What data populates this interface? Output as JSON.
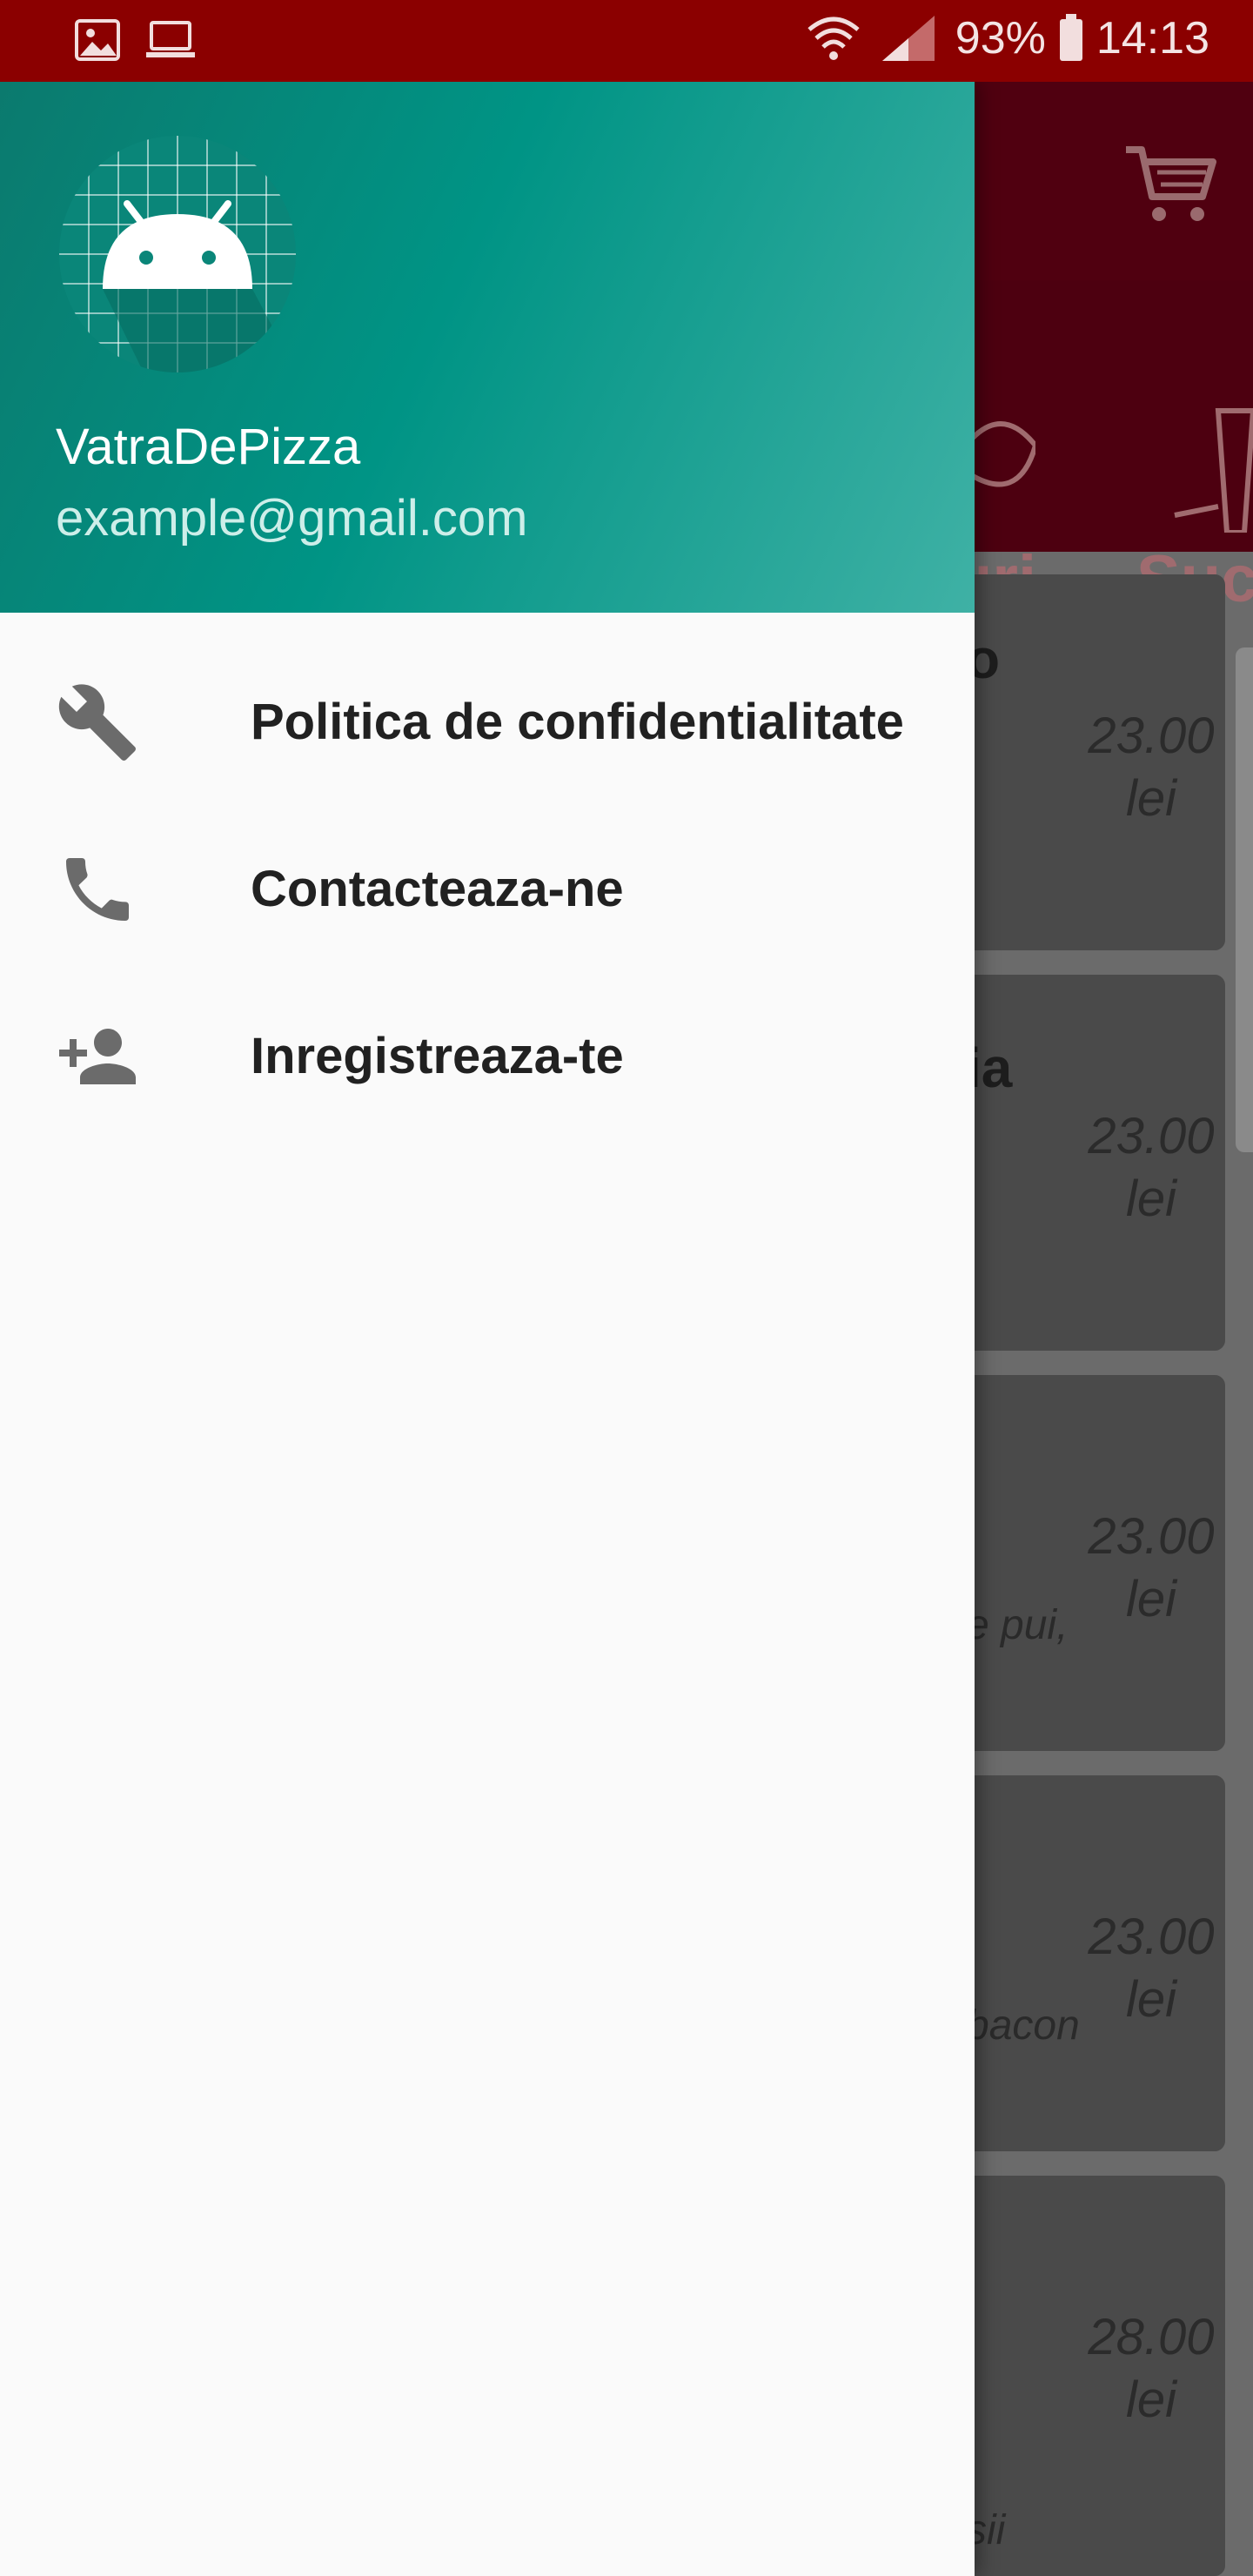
{
  "status_bar": {
    "battery": "93%",
    "time": "14:13"
  },
  "drawer": {
    "header": {
      "app_name": "VatraDePizza",
      "email": "example@gmail.com"
    },
    "menu": [
      {
        "icon": "wrench-icon",
        "label": "Politica de confidentialitate"
      },
      {
        "icon": "phone-icon",
        "label": "Contacteaza-ne"
      },
      {
        "icon": "add-person-icon",
        "label": "Inregistreaza-te"
      }
    ]
  },
  "background_app": {
    "categories": [
      {
        "label_fragment": "uri"
      },
      {
        "label_fragment": "Suc"
      }
    ],
    "products": [
      {
        "name_fragment": "o",
        "desc_fragment": "",
        "price": "23.00",
        "currency": "lei"
      },
      {
        "name_fragment": "ia",
        "desc_fragment": ",",
        "price": "23.00",
        "currency": "lei"
      },
      {
        "name_fragment": "",
        "desc_fragment": "e pui,",
        "price": "23.00",
        "currency": "lei"
      },
      {
        "name_fragment": "",
        "desc_fragment": "bacon",
        "price": "23.00",
        "currency": "lei"
      },
      {
        "name_fragment": "",
        "desc_fragment": "sii",
        "price": "28.00",
        "currency": "lei"
      }
    ]
  },
  "colors": {
    "status_bar": "#8b0000",
    "drawer_header": "#009485",
    "scrim_background": "#6b6b6b"
  }
}
